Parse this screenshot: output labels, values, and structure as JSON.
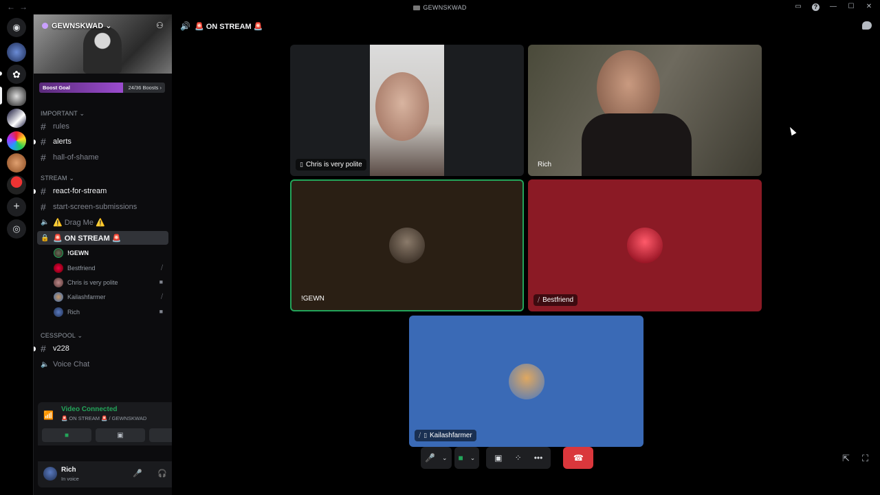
{
  "window": {
    "title": "GEWNSKWAD"
  },
  "server": {
    "name": "GEWNSKWAD",
    "boost_label": "Boost Goal",
    "boost_count": "24/36 Boosts",
    "boost_progress": 0.667
  },
  "categories": [
    {
      "name": "IMPORTANT"
    },
    {
      "name": "STREAM"
    },
    {
      "name": "CESSPOOL"
    }
  ],
  "channels": {
    "rules": "rules",
    "alerts": "alerts",
    "hall": "hall-of-shame",
    "react": "react-for-stream",
    "start": "start-screen-submissions",
    "drag": "⚠️ Drag Me ⚠️",
    "onstream": "🚨 ON STREAM 🚨",
    "v228": "v228",
    "voicechat": "Voice Chat"
  },
  "voice_users": [
    {
      "name": "!GEWN",
      "status": ""
    },
    {
      "name": "Bestfriend",
      "status": "muted"
    },
    {
      "name": "Chris is very polite",
      "status": "video"
    },
    {
      "name": "Kailashfarmer",
      "status": "muted"
    },
    {
      "name": "Rich",
      "status": "video"
    }
  ],
  "voice_panel": {
    "status": "Video Connected",
    "location": "🚨 ON STREAM 🚨 / GEWNSKWAD"
  },
  "user_panel": {
    "name": "Rich",
    "status": "In voice"
  },
  "header": {
    "channel": "🚨 ON STREAM 🚨"
  },
  "tiles": [
    {
      "label": "Chris is very polite",
      "icon": "mobile"
    },
    {
      "label": "Rich",
      "icon": ""
    },
    {
      "label": "!GEWN",
      "icon": ""
    },
    {
      "label": "Bestfriend",
      "icon": "muted"
    },
    {
      "label": "Kailashfarmer",
      "icon": "muted-mobile"
    }
  ],
  "colors": {
    "accent_green": "#23a55a",
    "danger": "#da373c",
    "bestfriend_bg": "#8b1a25",
    "kailash_bg": "#3a6ab6",
    "gewn_bg": "#2a1f14"
  }
}
